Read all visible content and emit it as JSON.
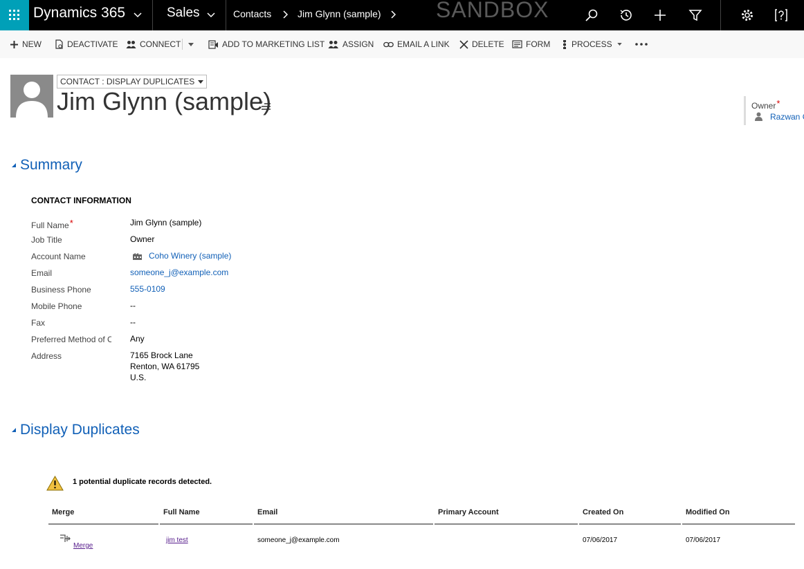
{
  "topbar": {
    "app_title": "Dynamics 365",
    "module": "Sales",
    "breadcrumb": [
      "Contacts",
      "Jim Glynn (sample)"
    ],
    "environment_label": "SANDBOX",
    "accent_color": "#00a0b8"
  },
  "commands": [
    {
      "label": "NEW",
      "icon": "plus-icon"
    },
    {
      "label": "DEACTIVATE",
      "icon": "document-icon"
    },
    {
      "label": "CONNECT",
      "icon": "people-icon"
    },
    {
      "label": "ADD TO MARKETING LIST",
      "icon": "marketing-list-icon"
    },
    {
      "label": "ASSIGN",
      "icon": "assign-icon"
    },
    {
      "label": "EMAIL A LINK",
      "icon": "link-icon"
    },
    {
      "label": "DELETE",
      "icon": "x-icon"
    },
    {
      "label": "FORM",
      "icon": "form-icon"
    },
    {
      "label": "PROCESS",
      "icon": "process-icon"
    }
  ],
  "header": {
    "form_selector": "CONTACT : DISPLAY DUPLICATES",
    "record_name": "Jim Glynn (sample)",
    "owner_label": "Owner",
    "owner_value": "Razwan C"
  },
  "summary": {
    "title": "Summary",
    "subheading": "CONTACT INFORMATION",
    "fields": [
      {
        "label": "Full Name",
        "value": "Jim Glynn (sample)",
        "required": true
      },
      {
        "label": "Job Title",
        "value": "Owner"
      },
      {
        "label": "Account Name",
        "value": "Coho Winery (sample)"
      },
      {
        "label": "Email",
        "value": "someone_j@example.com"
      },
      {
        "label": "Business Phone",
        "value": "555-0109"
      },
      {
        "label": "Mobile Phone",
        "value": "--"
      },
      {
        "label": "Fax",
        "value": "--"
      },
      {
        "label": "Preferred Method of Contact",
        "value": "Any"
      },
      {
        "label": "Address",
        "lines": [
          "7165 Brock Lane",
          "Renton, WA 61795",
          "U.S."
        ]
      }
    ]
  },
  "duplicates": {
    "title": "Display Duplicates",
    "message": "1 potential duplicate records detected.",
    "columns": [
      "Merge",
      "Full Name",
      "Email",
      "Primary Account",
      "Created On",
      "Modified On"
    ],
    "rows": [
      {
        "merge": "Merge",
        "full_name": "jim test",
        "email": "someone_j@example.com",
        "primary_account": "",
        "created_on": "07/06/2017",
        "modified_on": "07/06/2017"
      }
    ]
  }
}
